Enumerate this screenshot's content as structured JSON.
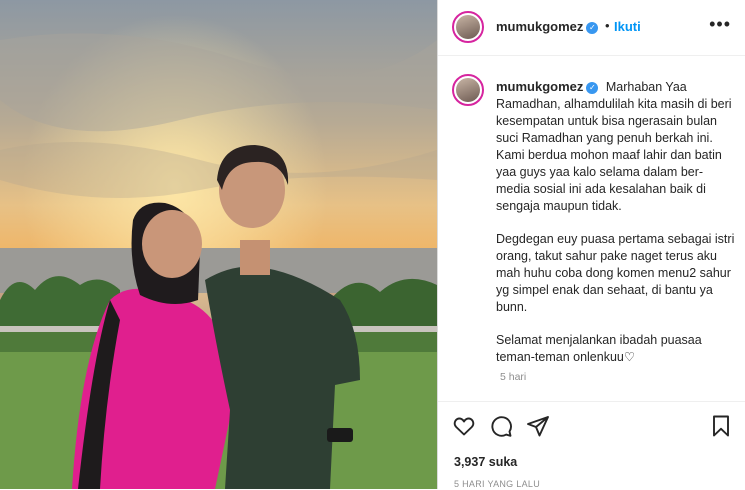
{
  "post": {
    "username": "mumukgomez",
    "follow_label": "Ikuti",
    "dot": "•",
    "more_label": "•••",
    "verified_mark": "✓",
    "caption_paragraphs": [
      "Marhaban Yaa Ramadhan, alhamdulilah kita masih di beri kesempatan untuk bisa ngerasain bulan suci Ramadhan yang penuh berkah ini. Kami berdua mohon maaf lahir dan batin yaa guys yaa kalo selama dalam ber-media sosial ini ada kesalahan baik di sengaja maupun tidak.",
      "Degdegan euy puasa pertama sebagai istri orang, takut sahur pake naget terus aku mah huhu coba dong komen menu2 sahur yg simpel enak dan sehaat, di bantu ya bunn.",
      "Selamat menjalankan ibadah puasaa teman-teman onlenkuu♡"
    ],
    "time_short": "5 hari",
    "likes": "3,937 suka",
    "time_long": "5 HARI YANG LALU"
  },
  "icons": {
    "like": "heart-icon",
    "comment": "comment-icon",
    "share": "share-icon",
    "save": "bookmark-icon"
  },
  "colors": {
    "accent": "#0095f6",
    "verified": "#3897f0",
    "muted": "#8e8e8e"
  }
}
